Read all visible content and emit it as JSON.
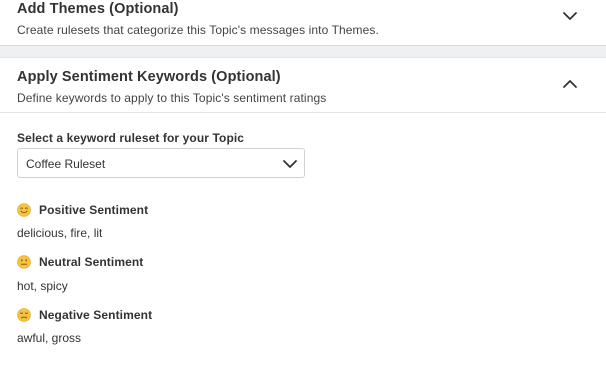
{
  "themes": {
    "title": "Add Themes (Optional)",
    "description": "Create rulesets that categorize this Topic's messages into Themes.",
    "toggle_icon": "chevron-down-icon"
  },
  "sentiment": {
    "title": "Apply Sentiment Keywords (Optional)",
    "description": "Define keywords to apply to this Topic's sentiment ratings",
    "toggle_icon": "chevron-up-icon"
  },
  "ruleset": {
    "label": "Select a keyword ruleset for your Topic",
    "selected": "Coffee Ruleset",
    "dropdown_icon": "chevron-down-icon"
  },
  "sentiments": {
    "positive": {
      "title": "Positive Sentiment",
      "keywords": "delicious, fire, lit",
      "icon": "smiling-face-icon"
    },
    "neutral": {
      "title": "Neutral Sentiment",
      "keywords": "hot, spicy",
      "icon": "neutral-face-icon"
    },
    "negative": {
      "title": "Negative Sentiment",
      "keywords": "awful, gross",
      "icon": "sad-face-icon"
    }
  },
  "colors": {
    "emoji_fill": "#f5c242",
    "emoji_stroke": "#8a5a12",
    "text_primary": "#333333",
    "divider": "#d9d9d9",
    "band": "#eef0f2"
  }
}
